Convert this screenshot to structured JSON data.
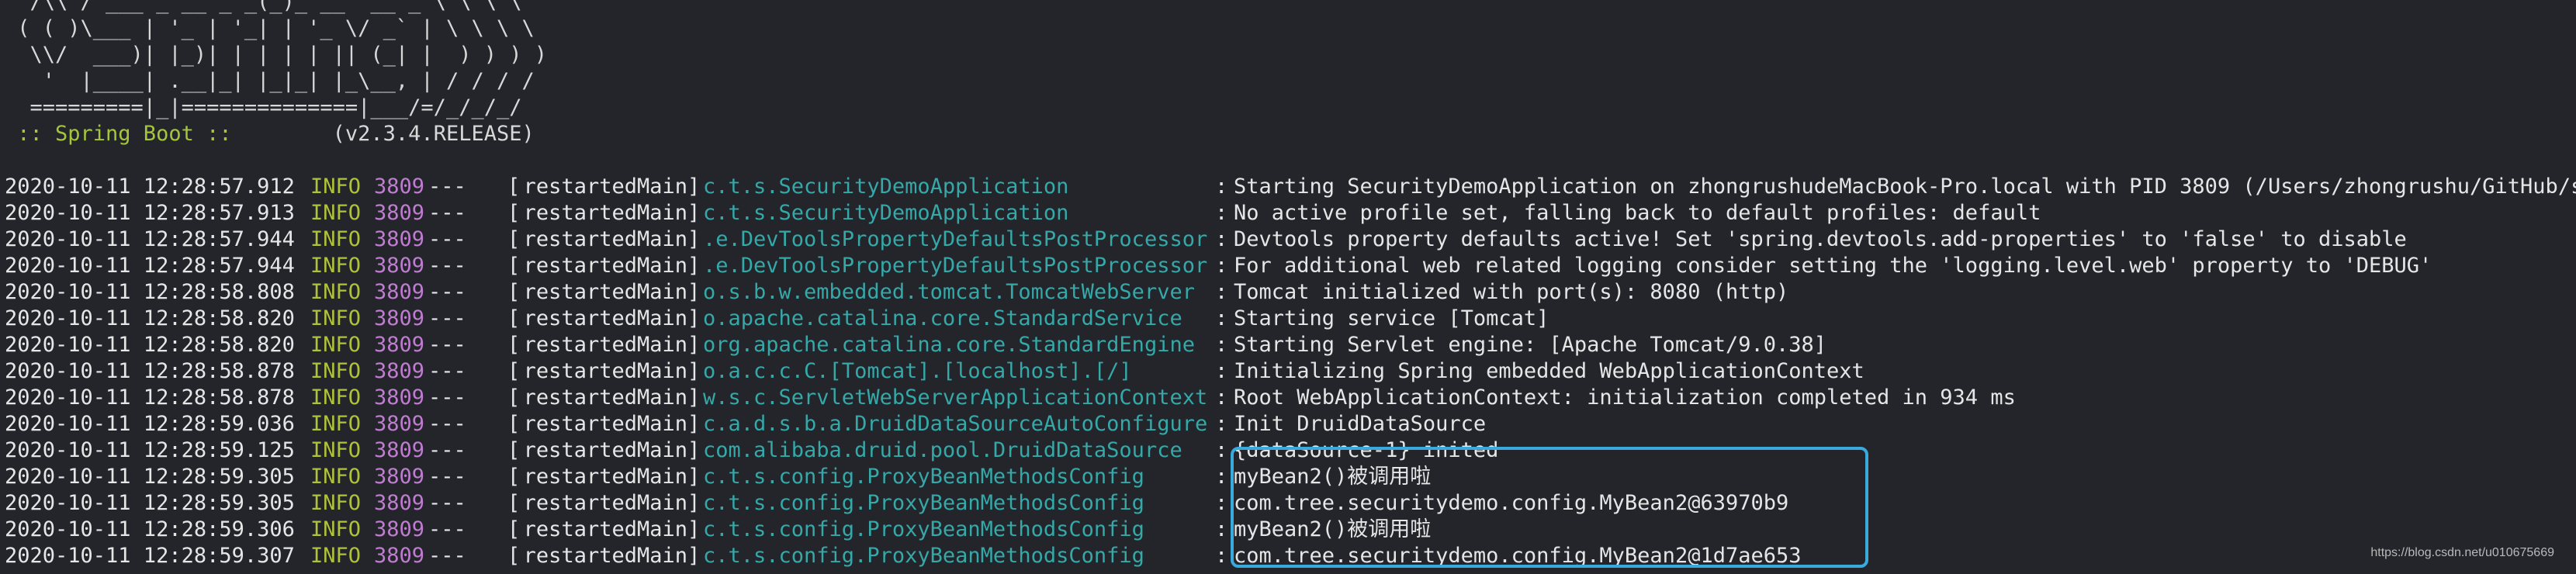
{
  "banner": {
    "lines": [
      "  /\\\\ / ___'_ __ _ _(_)_ __  __ _ \\ \\ \\ \\",
      " ( ( )\\___ | '_ | '_| | '_ \\/ _` | \\ \\ \\ \\",
      "  \\\\/  ___)| |_)| | | | | || (_| |  ) ) ) )",
      "   '  |____| .__|_| |_|_| |_\\__, | / / / /",
      "  =========|_|==============|___/=/_/_/_/"
    ],
    "spring_label": " :: Spring Boot :: ",
    "spring_version": "       (v2.3.4.RELEASE)"
  },
  "log_rows": [
    {
      "ts": "2020-10-11 12:28:57.912",
      "level": "INFO",
      "pid": "3809",
      "sep": "---",
      "thread": "restartedMain",
      "logger": "c.t.s.SecurityDemoApplication",
      "msg": "Starting SecurityDemoApplication on zhongrushudeMacBook-Pro.local with PID 3809 (/Users/zhongrushu/GitHub/se"
    },
    {
      "ts": "2020-10-11 12:28:57.913",
      "level": "INFO",
      "pid": "3809",
      "sep": "---",
      "thread": "restartedMain",
      "logger": "c.t.s.SecurityDemoApplication",
      "msg": "No active profile set, falling back to default profiles: default"
    },
    {
      "ts": "2020-10-11 12:28:57.944",
      "level": "INFO",
      "pid": "3809",
      "sep": "---",
      "thread": "restartedMain",
      "logger": ".e.DevToolsPropertyDefaultsPostProcessor",
      "msg": "Devtools property defaults active! Set 'spring.devtools.add-properties' to 'false' to disable"
    },
    {
      "ts": "2020-10-11 12:28:57.944",
      "level": "INFO",
      "pid": "3809",
      "sep": "---",
      "thread": "restartedMain",
      "logger": ".e.DevToolsPropertyDefaultsPostProcessor",
      "msg": "For additional web related logging consider setting the 'logging.level.web' property to 'DEBUG'"
    },
    {
      "ts": "2020-10-11 12:28:58.808",
      "level": "INFO",
      "pid": "3809",
      "sep": "---",
      "thread": "restartedMain",
      "logger": "o.s.b.w.embedded.tomcat.TomcatWebServer",
      "msg": "Tomcat initialized with port(s): 8080 (http)"
    },
    {
      "ts": "2020-10-11 12:28:58.820",
      "level": "INFO",
      "pid": "3809",
      "sep": "---",
      "thread": "restartedMain",
      "logger": "o.apache.catalina.core.StandardService",
      "msg": "Starting service [Tomcat]"
    },
    {
      "ts": "2020-10-11 12:28:58.820",
      "level": "INFO",
      "pid": "3809",
      "sep": "---",
      "thread": "restartedMain",
      "logger": "org.apache.catalina.core.StandardEngine",
      "msg": "Starting Servlet engine: [Apache Tomcat/9.0.38]"
    },
    {
      "ts": "2020-10-11 12:28:58.878",
      "level": "INFO",
      "pid": "3809",
      "sep": "---",
      "thread": "restartedMain",
      "logger": "o.a.c.c.C.[Tomcat].[localhost].[/]",
      "msg": "Initializing Spring embedded WebApplicationContext"
    },
    {
      "ts": "2020-10-11 12:28:58.878",
      "level": "INFO",
      "pid": "3809",
      "sep": "---",
      "thread": "restartedMain",
      "logger": "w.s.c.ServletWebServerApplicationContext",
      "msg": "Root WebApplicationContext: initialization completed in 934 ms"
    },
    {
      "ts": "2020-10-11 12:28:59.036",
      "level": "INFO",
      "pid": "3809",
      "sep": "---",
      "thread": "restartedMain",
      "logger": "c.a.d.s.b.a.DruidDataSourceAutoConfigure",
      "msg": "Init DruidDataSource"
    },
    {
      "ts": "2020-10-11 12:28:59.125",
      "level": "INFO",
      "pid": "3809",
      "sep": "---",
      "thread": "restartedMain",
      "logger": "com.alibaba.druid.pool.DruidDataSource",
      "msg": "{dataSource-1} inited"
    },
    {
      "ts": "2020-10-11 12:28:59.305",
      "level": "INFO",
      "pid": "3809",
      "sep": "---",
      "thread": "restartedMain",
      "logger": "c.t.s.config.ProxyBeanMethodsConfig",
      "msg": "myBean2()被调用啦"
    },
    {
      "ts": "2020-10-11 12:28:59.305",
      "level": "INFO",
      "pid": "3809",
      "sep": "---",
      "thread": "restartedMain",
      "logger": "c.t.s.config.ProxyBeanMethodsConfig",
      "msg": "com.tree.securitydemo.config.MyBean2@63970b9"
    },
    {
      "ts": "2020-10-11 12:28:59.306",
      "level": "INFO",
      "pid": "3809",
      "sep": "---",
      "thread": "restartedMain",
      "logger": "c.t.s.config.ProxyBeanMethodsConfig",
      "msg": "myBean2()被调用啦"
    },
    {
      "ts": "2020-10-11 12:28:59.307",
      "level": "INFO",
      "pid": "3809",
      "sep": "---",
      "thread": "restartedMain",
      "logger": "c.t.s.config.ProxyBeanMethodsConfig",
      "msg": "com.tree.securitydemo.config.MyBean2@1d7ae653"
    }
  ],
  "watermark": "https://blog.csdn.net/u010675669",
  "colors": {
    "background": "#23252b",
    "level": "#b0c23a",
    "pid": "#c07cd0",
    "logger": "#35a8a8",
    "spring_label": "#a6c63a",
    "highlight": "#3aa9dc"
  }
}
